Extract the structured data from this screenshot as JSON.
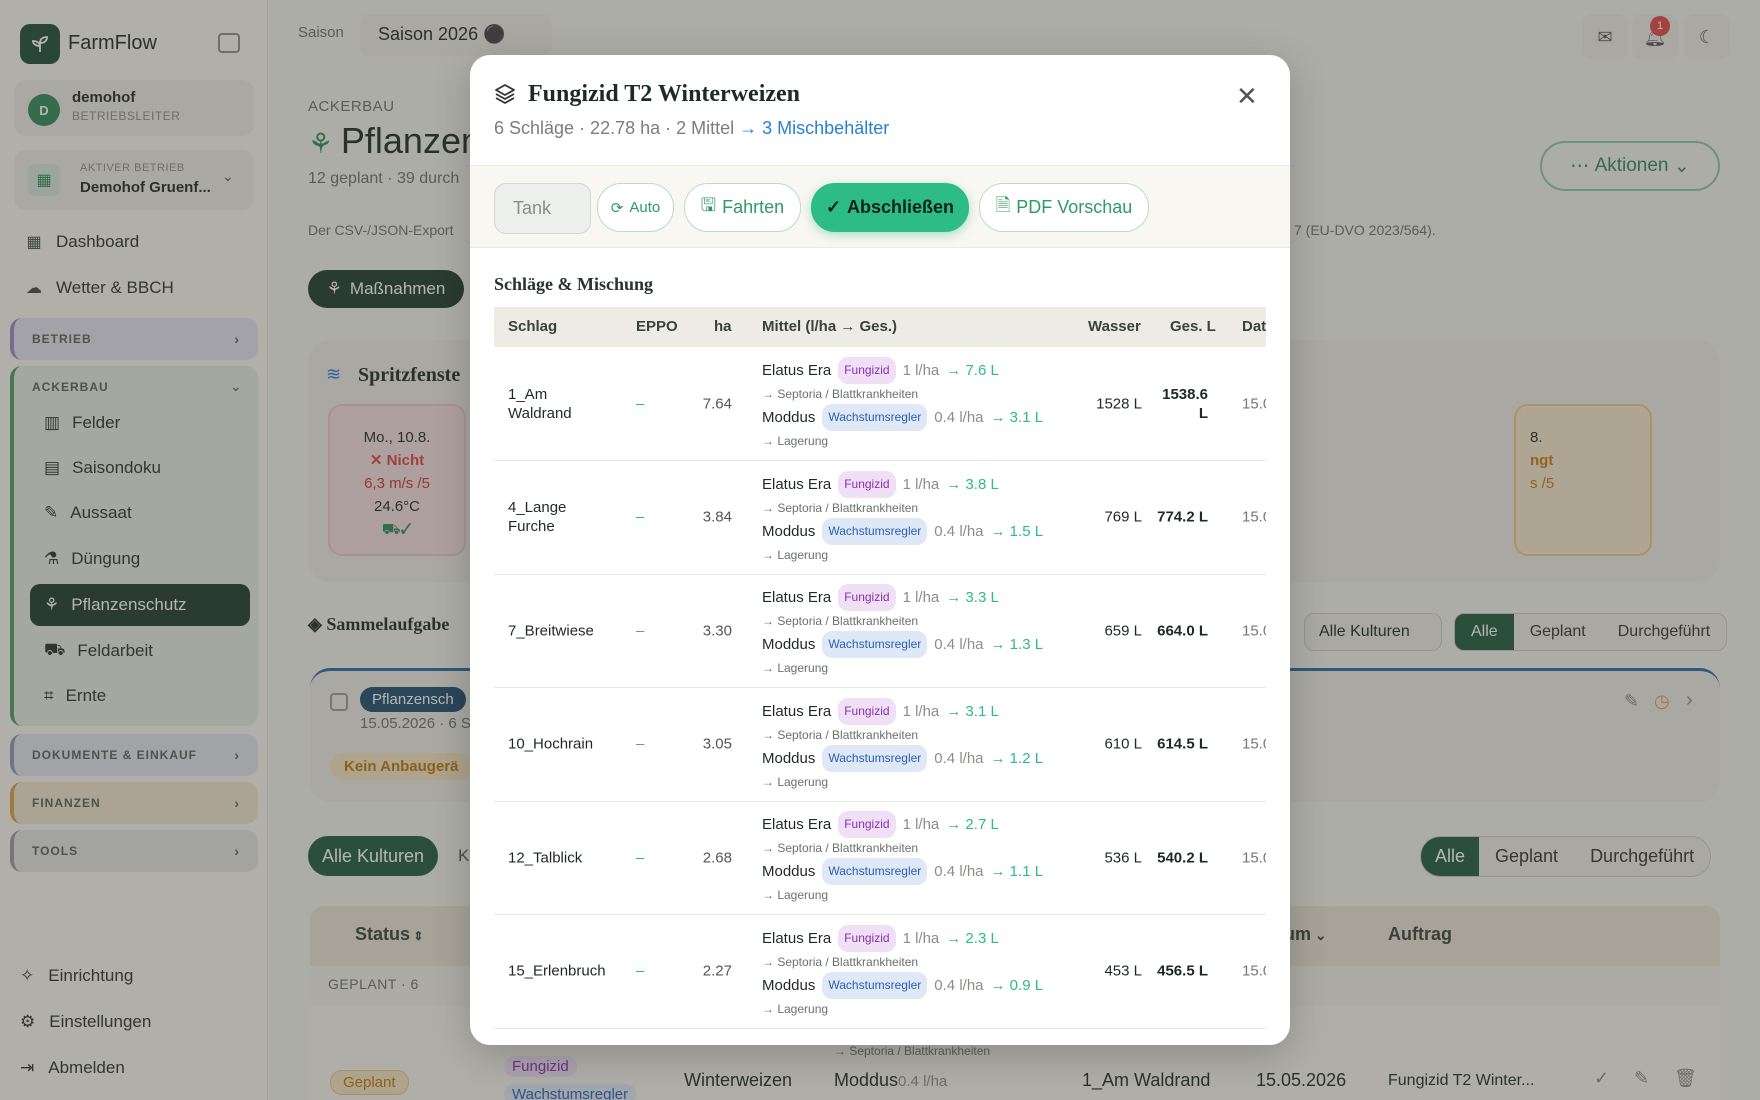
{
  "app": {
    "name": "FarmFlow"
  },
  "user": {
    "initial": "D",
    "name": "demohof",
    "role": "BETRIEBSLEITER"
  },
  "betrieb": {
    "label": "AKTIVER BETRIEB",
    "name": "Demohof Gruenf..."
  },
  "nav": {
    "dashboard": "Dashboard",
    "wetter": "Wetter & BBCH"
  },
  "groups": {
    "betrieb": "BETRIEB",
    "ackerbau": "ACKERBAU",
    "docs": "DOKUMENTE & EINKAUF",
    "finanzen": "FINANZEN",
    "tools": "TOOLS"
  },
  "ackerbau_items": [
    "Felder",
    "Saisondoku",
    "Aussaat",
    "Düngung",
    "Pflanzenschutz",
    "Feldarbeit",
    "Ernte"
  ],
  "bottom_nav": [
    "Einrichtung",
    "Einstellungen",
    "Abmelden"
  ],
  "topbar": {
    "season_label": "Saison",
    "season_value": "Saison 2026 ⚫",
    "notif_count": "1"
  },
  "page": {
    "crumb": "ACKERBAU",
    "title": "Pflanzenschutz",
    "subtitle": "12 geplant · 39 durch",
    "info": "Der CSV-/JSON-Export",
    "info2": "7 (EU-DVO 2023/564).",
    "aktionen": "Aktionen",
    "massnahmen": "Maßnahmen",
    "spritz_title": "Spritzfenste",
    "day1": {
      "date": "Mo., 10.8.",
      "status": "✕ Nicht",
      "wind": "6,3 m/s /5",
      "temp": "24.6°C"
    },
    "day2": {
      "date": "8.",
      "status": "ngt",
      "wind": "s /5"
    },
    "sammel_title": "Sammelaufgabe",
    "filter_kultur": "Alle Kulturen",
    "seg": [
      "Alle",
      "Geplant",
      "Durchgeführt"
    ],
    "task_chip": "Pflanzensch",
    "task_meta": "15.05.2026 · 6 Sc",
    "task_warn": "Kein Anbaugerä",
    "all_kulturen": "Alle Kulturen",
    "kult_trunc": "Ku",
    "table_head": {
      "status": "Status",
      "datum": "tum",
      "auftrag": "Auftrag"
    },
    "group_label": "GEPLANT · 6",
    "row": {
      "status": "Geplant",
      "tag1": "Fungizid",
      "tag2": "Wachstumsregler",
      "kultur": "Winterweizen",
      "target": "→ Septoria / Blattkrankheiten",
      "mittel": "Moddus",
      "dose": "0.4 l/ha",
      "schlag": "1_Am Waldrand",
      "date": "15.05.2026",
      "auftrag": "Fungizid T2 Winter..."
    }
  },
  "modal": {
    "title": "Fungizid T2 Winterweizen",
    "subtitle": "6 Schläge · 22.78 ha · 2 Mittel",
    "link": "→ 3 Mischbehälter",
    "tank_placeholder": "Tank",
    "buttons": {
      "auto": "Auto",
      "fahrten": "Fahrten",
      "abschliessen": "Abschließen",
      "pdf": "PDF Vorschau"
    },
    "section": "Schläge & Mischung",
    "columns": {
      "schlag": "Schlag",
      "eppo": "EPPO",
      "ha": "ha",
      "mittel": "Mittel (l/ha → Ges.)",
      "wasser": "Wasser",
      "gesl": "Ges. L",
      "dat": "Dat"
    },
    "rows": [
      {
        "schlag": "1_Am Waldrand",
        "eppo": "–",
        "ha": "7.64",
        "m1_name": "Elatus Era",
        "m1_tag": "Fungizid",
        "m1_dose": "1 l/ha",
        "m1_total": "→ 7.6 L",
        "m1_target": "→ Septoria / Blattkrankheiten",
        "m2_name": "Moddus",
        "m2_tag": "Wachstumsregler",
        "m2_dose": "0.4 l/ha",
        "m2_total": "→ 3.1 L",
        "m2_target": "→ Lagerung",
        "wasser": "1528 L",
        "gesl": "1538.6 L",
        "dat": "15.0"
      },
      {
        "schlag": "4_Lange Furche",
        "eppo": "–",
        "ha": "3.84",
        "m1_name": "Elatus Era",
        "m1_tag": "Fungizid",
        "m1_dose": "1 l/ha",
        "m1_total": "→ 3.8 L",
        "m1_target": "→ Septoria / Blattkrankheiten",
        "m2_name": "Moddus",
        "m2_tag": "Wachstumsregler",
        "m2_dose": "0.4 l/ha",
        "m2_total": "→ 1.5 L",
        "m2_target": "→ Lagerung",
        "wasser": "769 L",
        "gesl": "774.2 L",
        "dat": "15.0"
      },
      {
        "schlag": "7_Breitwiese",
        "eppo": "–",
        "ha": "3.30",
        "m1_name": "Elatus Era",
        "m1_tag": "Fungizid",
        "m1_dose": "1 l/ha",
        "m1_total": "→ 3.3 L",
        "m1_target": "→ Septoria / Blattkrankheiten",
        "m2_name": "Moddus",
        "m2_tag": "Wachstumsregler",
        "m2_dose": "0.4 l/ha",
        "m2_total": "→ 1.3 L",
        "m2_target": "→ Lagerung",
        "wasser": "659 L",
        "gesl": "664.0 L",
        "dat": "15.0"
      },
      {
        "schlag": "10_Hochrain",
        "eppo": "–",
        "ha": "3.05",
        "m1_name": "Elatus Era",
        "m1_tag": "Fungizid",
        "m1_dose": "1 l/ha",
        "m1_total": "→ 3.1 L",
        "m1_target": "→ Septoria / Blattkrankheiten",
        "m2_name": "Moddus",
        "m2_tag": "Wachstumsregler",
        "m2_dose": "0.4 l/ha",
        "m2_total": "→ 1.2 L",
        "m2_target": "→ Lagerung",
        "wasser": "610 L",
        "gesl": "614.5 L",
        "dat": "15.0"
      },
      {
        "schlag": "12_Talblick",
        "eppo": "–",
        "ha": "2.68",
        "m1_name": "Elatus Era",
        "m1_tag": "Fungizid",
        "m1_dose": "1 l/ha",
        "m1_total": "→ 2.7 L",
        "m1_target": "→ Septoria / Blattkrankheiten",
        "m2_name": "Moddus",
        "m2_tag": "Wachstumsregler",
        "m2_dose": "0.4 l/ha",
        "m2_total": "→ 1.1 L",
        "m2_target": "→ Lagerung",
        "wasser": "536 L",
        "gesl": "540.2 L",
        "dat": "15.0"
      },
      {
        "schlag": "15_Erlenbruch",
        "eppo": "–",
        "ha": "2.27",
        "m1_name": "Elatus Era",
        "m1_tag": "Fungizid",
        "m1_dose": "1 l/ha",
        "m1_total": "→ 2.3 L",
        "m1_target": "→ Septoria / Blattkrankheiten",
        "m2_name": "Moddus",
        "m2_tag": "Wachstumsregler",
        "m2_dose": "0.4 l/ha",
        "m2_total": "→ 0.9 L",
        "m2_target": "→ Lagerung",
        "wasser": "453 L",
        "gesl": "456.5 L",
        "dat": "15.0"
      }
    ]
  }
}
